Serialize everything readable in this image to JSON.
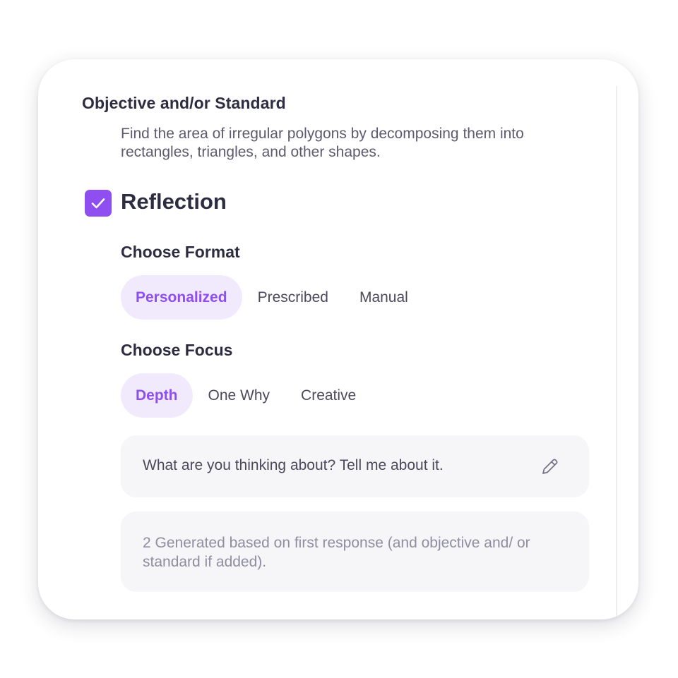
{
  "objective": {
    "title": "Objective and/or Standard",
    "text": "Find the area of irregular polygons by decomposing them into rectangles, triangles, and other shapes."
  },
  "reflection": {
    "checked": true,
    "title": "Reflection",
    "checkbox_icon": "checkmark-icon"
  },
  "format": {
    "label": "Choose Format",
    "options": [
      "Personalized",
      "Prescribed",
      "Manual"
    ],
    "selected": "Personalized"
  },
  "focus": {
    "label": "Choose Focus",
    "options": [
      "Depth",
      "One Why",
      "Creative"
    ],
    "selected": "Depth"
  },
  "prompt": {
    "text": "What are you thinking about? Tell me about it.",
    "edit_icon": "pencil-icon"
  },
  "generated": {
    "text": "2 Generated based on first response (and objective and/ or standard if added)."
  },
  "colors": {
    "accent": "#8E4EF0",
    "accent_bg": "#F1EAFC",
    "text_dark": "#2E2C40",
    "text_muted": "#8F8DA0",
    "box_bg": "#F6F6F8"
  }
}
